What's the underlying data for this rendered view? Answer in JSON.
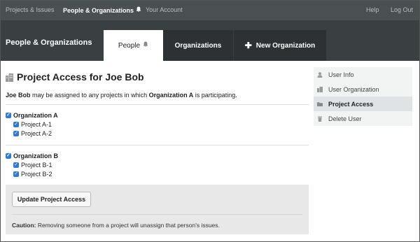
{
  "topnav": {
    "items": [
      {
        "label": "Projects & Issues"
      },
      {
        "label": "People & Organizations"
      },
      {
        "label": "Your Account"
      },
      {
        "label": "Help"
      },
      {
        "label": "Log Out"
      }
    ]
  },
  "header": {
    "section_title": "People & Organizations",
    "tabs": [
      {
        "label": "People"
      },
      {
        "label": "Organizations"
      },
      {
        "label": "New Organization"
      }
    ]
  },
  "main": {
    "title": "Project Access for Joe Bob",
    "desc": {
      "person": "Joe Bob",
      "middle": " may be assigned to any projects in which ",
      "org": "Organization A",
      "end": " is participating."
    },
    "orgs": [
      {
        "name": "Organization A",
        "checked": true,
        "projects": [
          {
            "name": "Project A-1",
            "checked": true
          },
          {
            "name": "Project A-2",
            "checked": true
          }
        ]
      },
      {
        "name": "Organization B",
        "checked": true,
        "projects": [
          {
            "name": "Project B-1",
            "checked": true
          },
          {
            "name": "Project B-2",
            "checked": true
          }
        ]
      }
    ],
    "update_button": "Update Project Access",
    "caution_label": "Caution:",
    "caution_text": " Removing someone from a project will unassign that person's issues."
  },
  "sidebar": {
    "items": [
      {
        "label": "User Info",
        "icon": "user-icon"
      },
      {
        "label": "User Organization",
        "icon": "building-icon"
      },
      {
        "label": "Project Access",
        "icon": "folder-icon"
      },
      {
        "label": "Delete User",
        "icon": "trash-icon"
      }
    ]
  },
  "colors": {
    "topnav_bg": "#4a4f52",
    "header_bg": "#3a3f42",
    "tab_bg": "#2d3133",
    "checkbox": "#2f7ad8"
  }
}
